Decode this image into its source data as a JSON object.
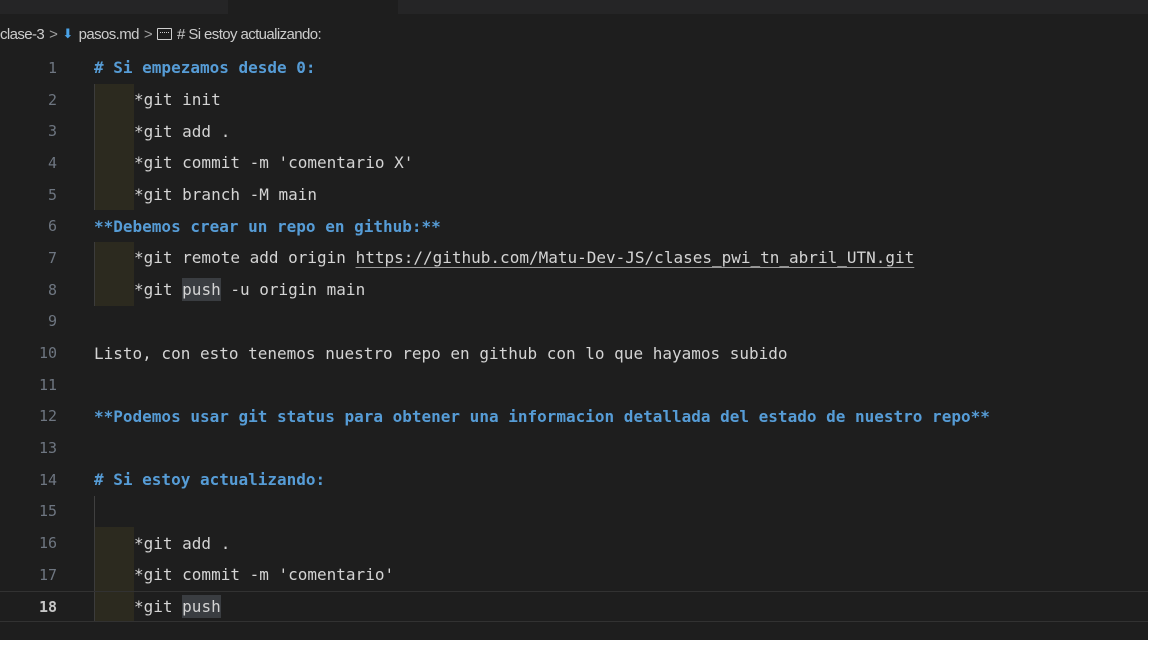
{
  "breadcrumb": {
    "folder": "clase-3",
    "file": "pasos.md",
    "symbol": "# Si estoy actualizando:",
    "separator": ">"
  },
  "editor": {
    "current_line": 18,
    "lines": [
      {
        "n": "1",
        "pre": "# Si empezamos desde 0:"
      },
      {
        "n": "2",
        "pre": "*git init"
      },
      {
        "n": "3",
        "pre": "*git add ."
      },
      {
        "n": "4",
        "pre": "*git commit -m 'comentario X'"
      },
      {
        "n": "5",
        "pre": "*git branch -M main"
      },
      {
        "n": "6",
        "pre": "**Debemos crear un repo en github:**"
      },
      {
        "n": "7",
        "pre": "*git remote add origin ",
        "link": "https://github.com/Matu-Dev-JS/clases_pwi_tn_abril_UTN.git"
      },
      {
        "n": "8",
        "pre": "*git ",
        "hl": "push",
        "post": " -u origin main"
      },
      {
        "n": "9",
        "pre": ""
      },
      {
        "n": "10",
        "pre": "Listo, con esto tenemos nuestro repo en github con lo que hayamos subido"
      },
      {
        "n": "11",
        "pre": ""
      },
      {
        "n": "12",
        "pre": "**Podemos usar git status para obtener una informacion detallada del estado de nuestro repo**"
      },
      {
        "n": "13",
        "pre": ""
      },
      {
        "n": "14",
        "pre": "# Si estoy actualizando:"
      },
      {
        "n": "15",
        "pre": ""
      },
      {
        "n": "16",
        "pre": "*git add ."
      },
      {
        "n": "17",
        "pre": "*git commit -m 'comentario'"
      },
      {
        "n": "18",
        "pre": "*git ",
        "hl": "push"
      }
    ]
  },
  "colors": {
    "background": "#1e1e1e",
    "heading": "#569cd6",
    "text": "#d4d4d4",
    "line_number": "#6e7681",
    "highlight": "#3a3d41"
  },
  "icons": {
    "markdown_file": "markdown-down-arrow-icon",
    "symbol": "symbol-key-icon"
  }
}
